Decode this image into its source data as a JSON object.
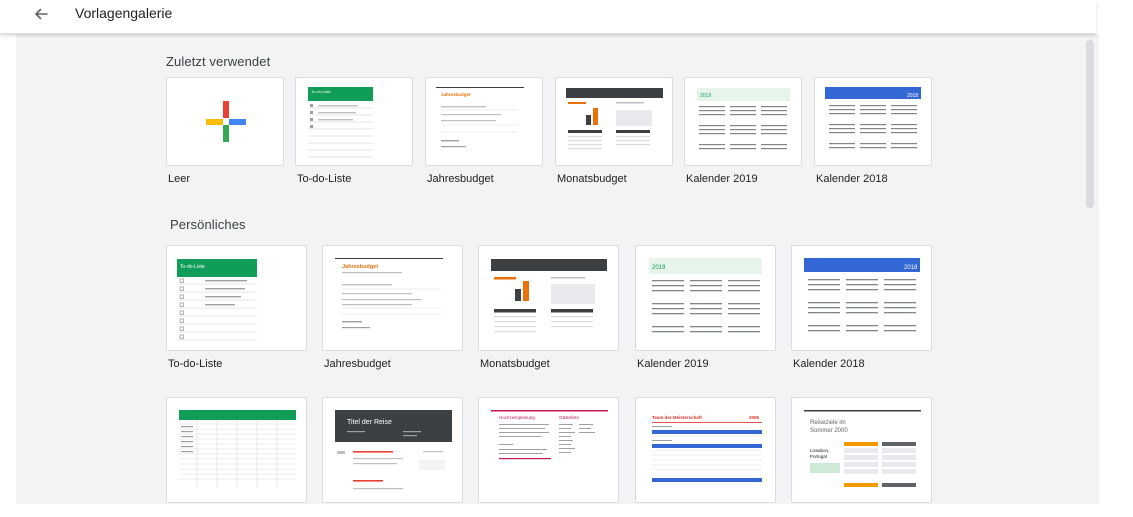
{
  "header": {
    "title": "Vorlagengalerie",
    "back_icon": "arrow-left-icon"
  },
  "sections": {
    "recent": {
      "title": "Zuletzt verwendet",
      "items": [
        "Leer",
        "To-do-Liste",
        "Jahresbudget",
        "Monatsbudget",
        "Kalender 2019",
        "Kalender 2018"
      ]
    },
    "personal": {
      "title": "Persönliches",
      "items": [
        "To-do-Liste",
        "Jahresbudget",
        "Monatsbudget",
        "Kalender 2019",
        "Kalender 2018"
      ]
    }
  },
  "thumbnails": {
    "todo_heading": "To-do-Liste",
    "annual_heading": "Jahresbudget",
    "calendar_2019": "2019",
    "calendar_2018": "2018",
    "travel_heading": "Titel der Reise",
    "football_heading": "Team der Meisterschaft",
    "football_year": "2006",
    "itinerary_heading": "Reiseziele im Sommer 2000",
    "itinerary_place": "Lissabon, Portugal",
    "wedding_heading": "Hochzeitsplanung",
    "wedding_sub": "Gästeliste"
  },
  "colors": {
    "green": "#0f9d58",
    "blue": "#3367d6",
    "orange": "#e8710a",
    "dark_header": "#3c4043",
    "calendar_tint": "#e6f4ea",
    "plus_red": "#ea4335",
    "plus_blue": "#4285f4",
    "plus_green": "#34a853",
    "plus_yellow": "#fbbc04",
    "pink": "#c2185b"
  }
}
